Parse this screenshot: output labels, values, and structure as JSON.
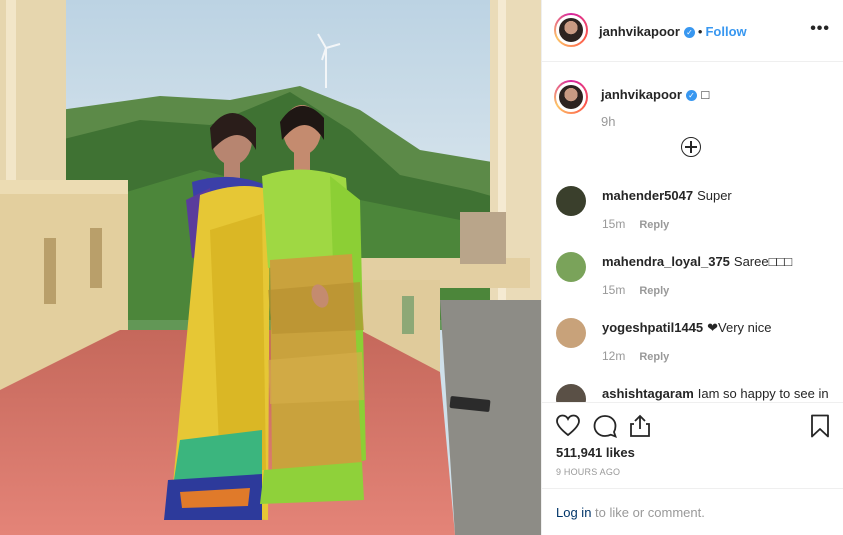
{
  "post": {
    "username": "janhvikapoor",
    "follow_label": "Follow",
    "separator": "•",
    "more_label": "•••",
    "verified_mark": "✓"
  },
  "caption": {
    "username": "janhvikapoor",
    "text": "□",
    "time": "9h"
  },
  "comments": [
    {
      "user": "mahender5047",
      "text": "Super",
      "time": "15m",
      "reply": "Reply",
      "avatar_color": "#3a3f2c"
    },
    {
      "user": "mahendra_loyal_375",
      "text": "Saree□□□",
      "time": "15m",
      "reply": "Reply",
      "avatar_color": "#7aa35a"
    },
    {
      "user": "yogeshpatil1445",
      "text": "❤Very nice",
      "time": "12m",
      "reply": "Reply",
      "avatar_color": "#c8a27a"
    },
    {
      "user": "ashishtagaram",
      "text": "Iam so happy to see in",
      "time": "",
      "reply": "",
      "avatar_color": "#5a5046"
    }
  ],
  "actions": {
    "likes": "511,941 likes",
    "time_ago": "9 HOURS AGO"
  },
  "footer": {
    "login": "Log in",
    "rest": " to like or comment."
  },
  "icons": {
    "like": "heart-icon",
    "comment": "comment-icon",
    "share": "share-icon",
    "save": "bookmark-icon"
  }
}
